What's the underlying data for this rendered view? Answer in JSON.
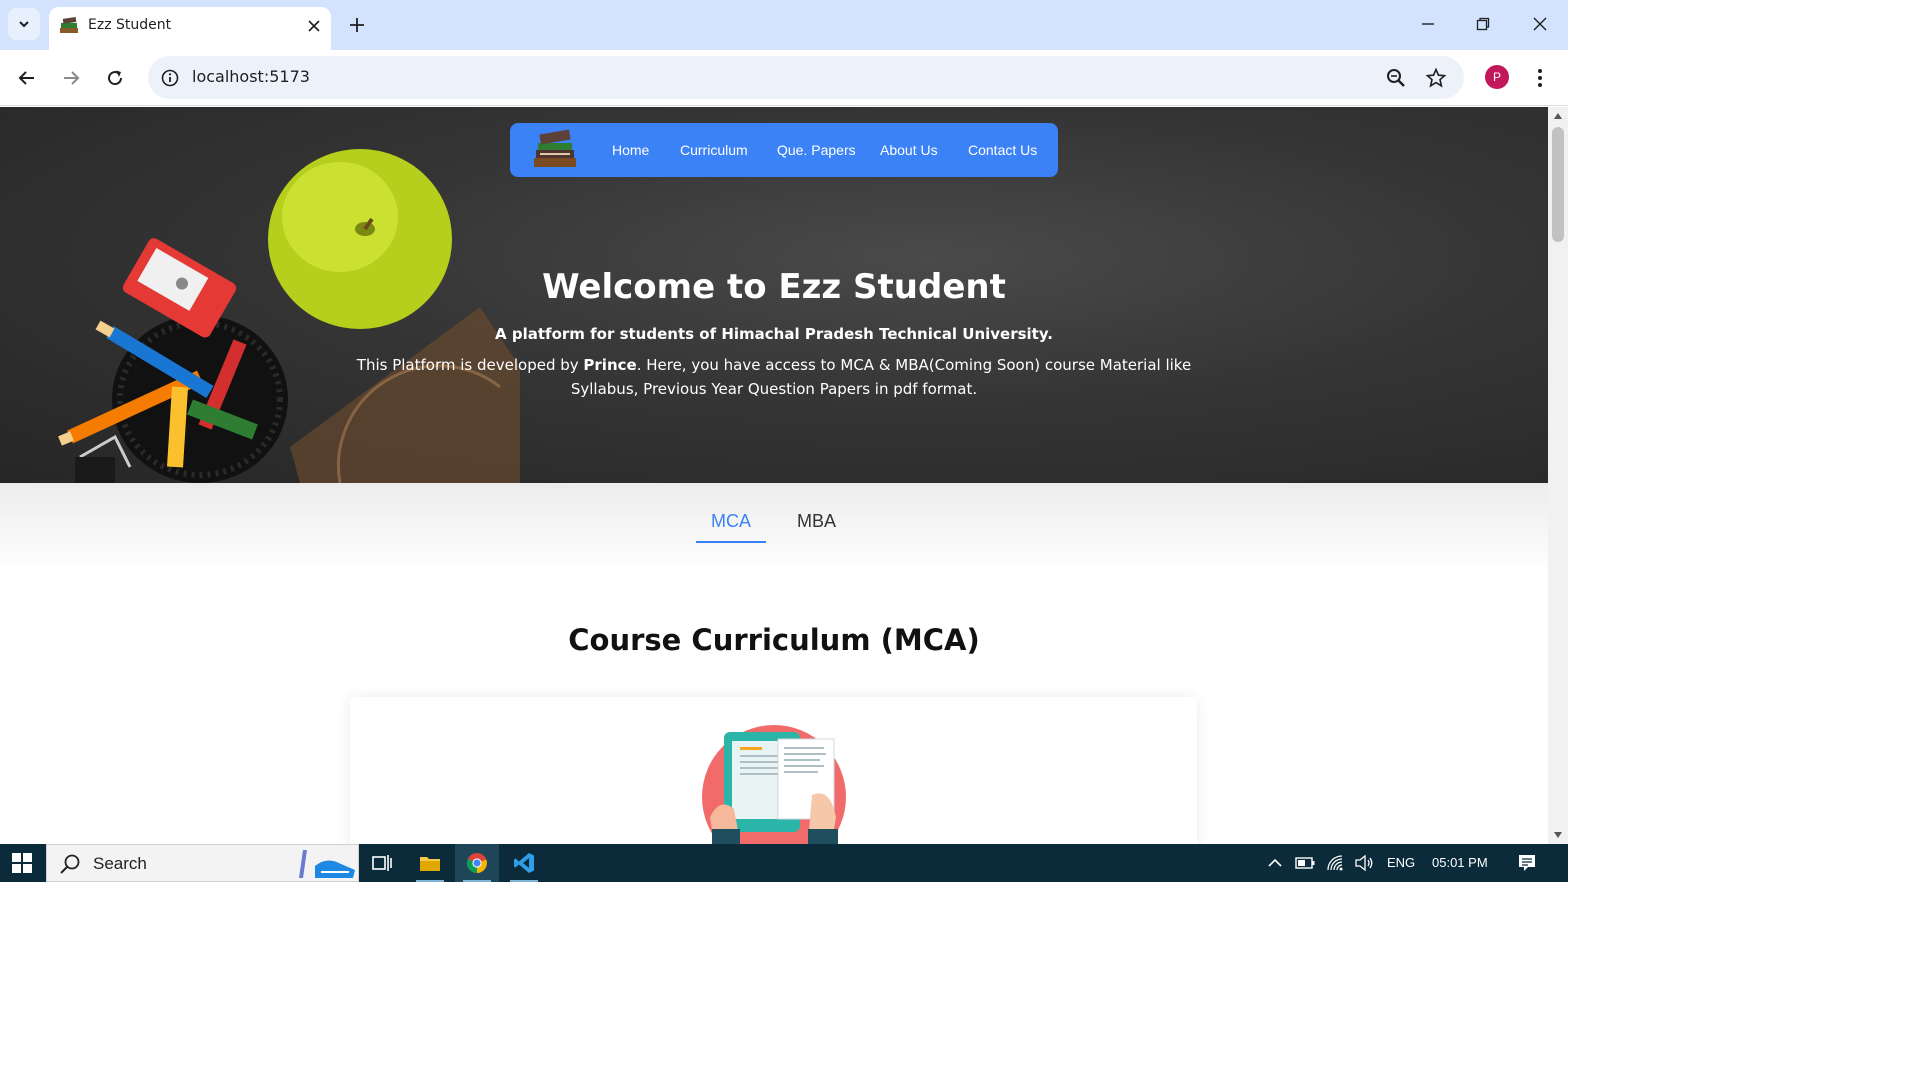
{
  "browser": {
    "tab_title": "Ezz Student",
    "url": "localhost:5173",
    "profile_initial": "P",
    "icons": {
      "tab_search": "chevron-down-icon",
      "close_tab": "close-icon",
      "new_tab": "plus-icon",
      "back": "arrow-left-icon",
      "forward": "arrow-right-icon",
      "reload": "reload-icon",
      "site_info": "info-icon",
      "zoom": "zoom-icon",
      "bookmark": "star-icon",
      "menu": "kebab-icon"
    }
  },
  "navbar": {
    "links": [
      {
        "label": "Home"
      },
      {
        "label": "Curriculum"
      },
      {
        "label": "Que. Papers"
      },
      {
        "label": "About Us"
      },
      {
        "label": "Contact Us"
      }
    ]
  },
  "hero": {
    "title": "Welcome to Ezz Student",
    "subtitle": "A platform for students of Himachal Pradesh Technical University.",
    "desc_prefix": "This Platform is developed by ",
    "desc_author": "Prince",
    "desc_suffix": ". Here, you have access to MCA & MBA(Coming Soon) course Material like Syllabus, Previous Year Question Papers in pdf format."
  },
  "course_tabs": {
    "items": [
      {
        "label": "MCA",
        "selected": true
      },
      {
        "label": "MBA",
        "selected": false
      }
    ]
  },
  "section": {
    "title": "Course Curriculum (MCA)"
  },
  "taskbar": {
    "search_placeholder": "Search",
    "language": "ENG",
    "time": "05:01 PM"
  },
  "colors": {
    "accent": "#3b82f6",
    "tabstrip": "#d3e3fd",
    "taskbar": "#0b2b3b"
  }
}
